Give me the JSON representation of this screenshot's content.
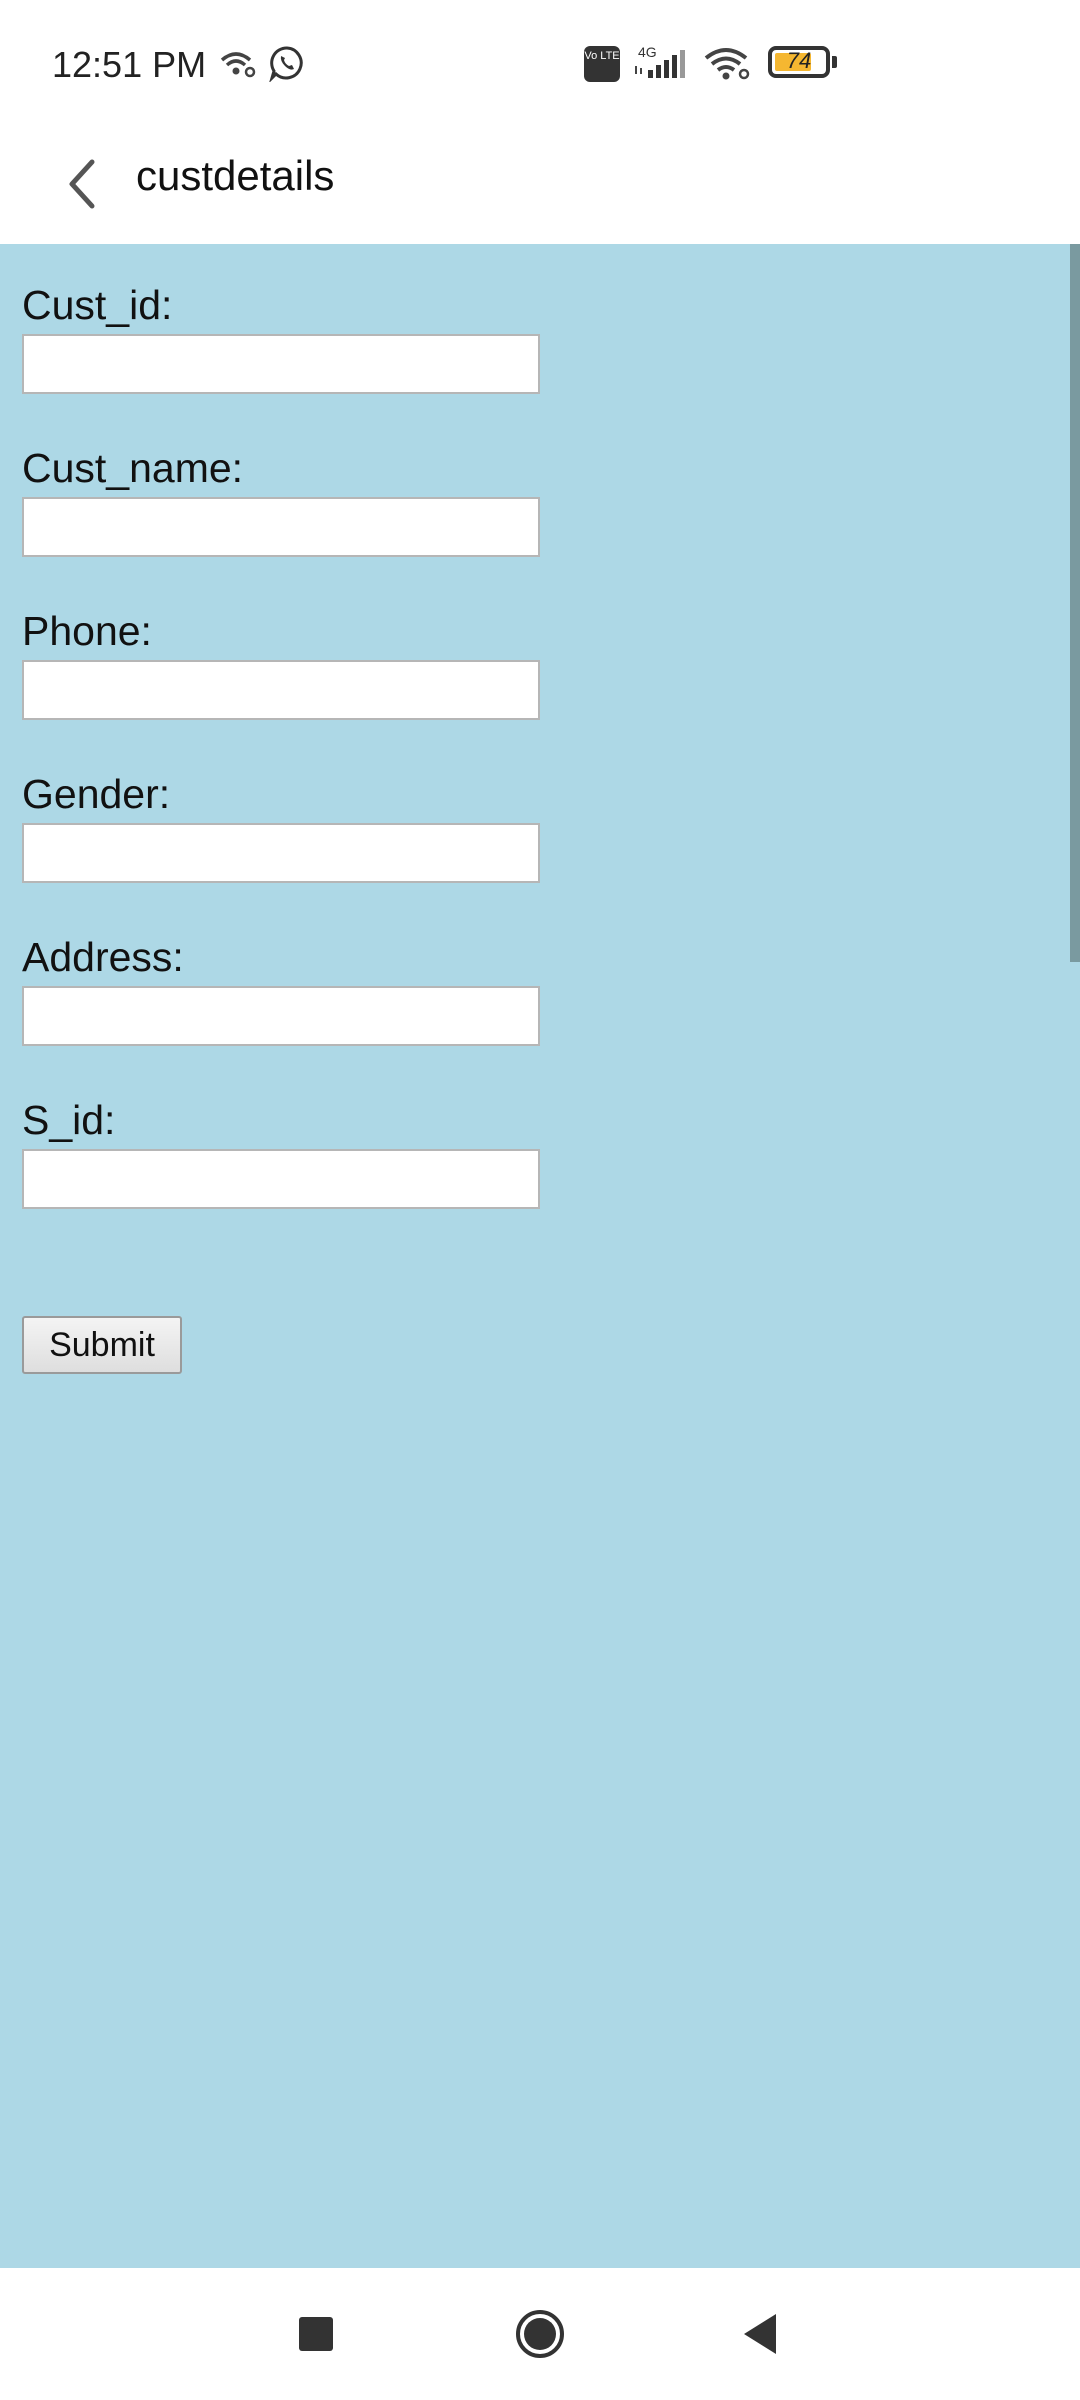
{
  "status_bar": {
    "time": "12:51 PM",
    "volte_label": "Vo LTE",
    "network_label": "4G",
    "battery_level": "74",
    "battery_fraction": 0.74,
    "icons": [
      "hotspot-icon",
      "whatsapp-icon",
      "volte-icon",
      "signal-icon",
      "wifi-icon",
      "battery-icon"
    ]
  },
  "app_bar": {
    "title": "custdetails",
    "back_icon": "chevron-left-icon"
  },
  "form": {
    "fields": [
      {
        "label": "Cust_id:",
        "value": "",
        "placeholder": ""
      },
      {
        "label": "Cust_name:",
        "value": "",
        "placeholder": ""
      },
      {
        "label": "Phone:",
        "value": "",
        "placeholder": ""
      },
      {
        "label": "Gender:",
        "value": "",
        "placeholder": ""
      },
      {
        "label": "Address:",
        "value": "",
        "placeholder": ""
      },
      {
        "label": "S_id:",
        "value": "",
        "placeholder": ""
      }
    ],
    "submit_label": "Submit",
    "background_color": "#add8e6"
  },
  "nav_bar": {
    "buttons": [
      "recent-apps-icon",
      "home-icon",
      "back-icon"
    ]
  }
}
